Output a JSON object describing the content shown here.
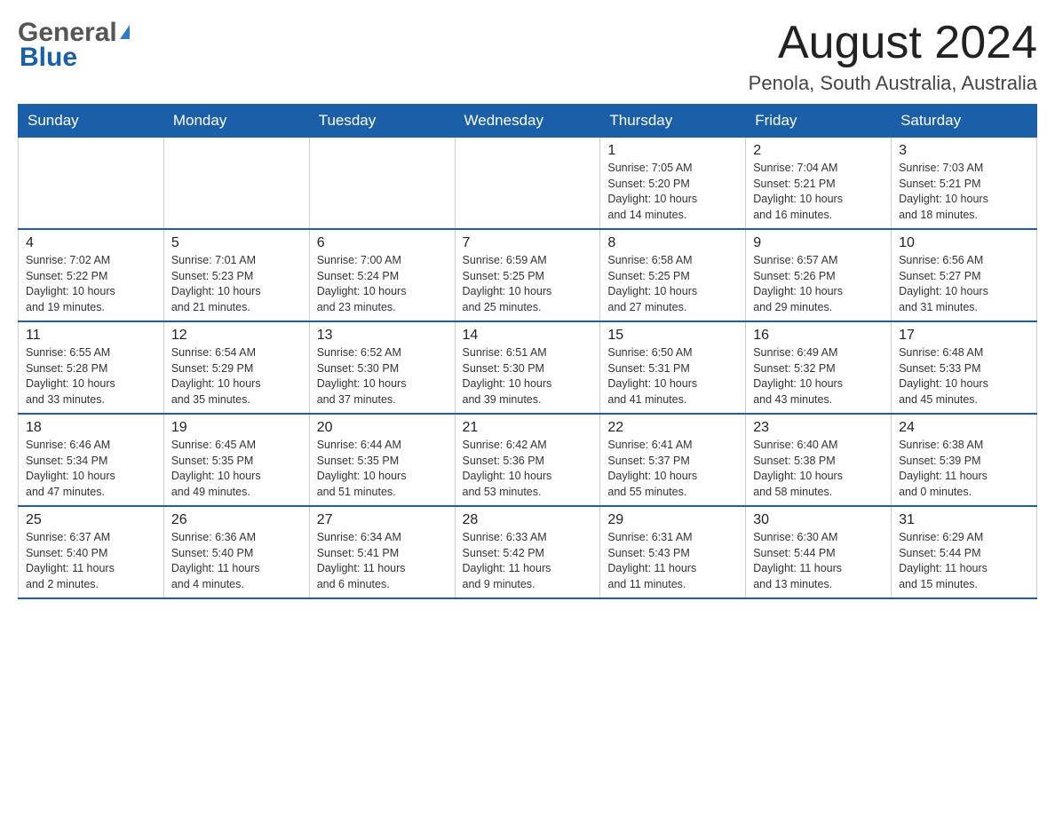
{
  "header": {
    "logo_general": "General",
    "logo_blue": "Blue",
    "month_title": "August 2024",
    "location": "Penola, South Australia, Australia"
  },
  "weekdays": [
    "Sunday",
    "Monday",
    "Tuesday",
    "Wednesday",
    "Thursday",
    "Friday",
    "Saturday"
  ],
  "weeks": [
    [
      {
        "day": "",
        "detail": ""
      },
      {
        "day": "",
        "detail": ""
      },
      {
        "day": "",
        "detail": ""
      },
      {
        "day": "",
        "detail": ""
      },
      {
        "day": "1",
        "detail": "Sunrise: 7:05 AM\nSunset: 5:20 PM\nDaylight: 10 hours\nand 14 minutes."
      },
      {
        "day": "2",
        "detail": "Sunrise: 7:04 AM\nSunset: 5:21 PM\nDaylight: 10 hours\nand 16 minutes."
      },
      {
        "day": "3",
        "detail": "Sunrise: 7:03 AM\nSunset: 5:21 PM\nDaylight: 10 hours\nand 18 minutes."
      }
    ],
    [
      {
        "day": "4",
        "detail": "Sunrise: 7:02 AM\nSunset: 5:22 PM\nDaylight: 10 hours\nand 19 minutes."
      },
      {
        "day": "5",
        "detail": "Sunrise: 7:01 AM\nSunset: 5:23 PM\nDaylight: 10 hours\nand 21 minutes."
      },
      {
        "day": "6",
        "detail": "Sunrise: 7:00 AM\nSunset: 5:24 PM\nDaylight: 10 hours\nand 23 minutes."
      },
      {
        "day": "7",
        "detail": "Sunrise: 6:59 AM\nSunset: 5:25 PM\nDaylight: 10 hours\nand 25 minutes."
      },
      {
        "day": "8",
        "detail": "Sunrise: 6:58 AM\nSunset: 5:25 PM\nDaylight: 10 hours\nand 27 minutes."
      },
      {
        "day": "9",
        "detail": "Sunrise: 6:57 AM\nSunset: 5:26 PM\nDaylight: 10 hours\nand 29 minutes."
      },
      {
        "day": "10",
        "detail": "Sunrise: 6:56 AM\nSunset: 5:27 PM\nDaylight: 10 hours\nand 31 minutes."
      }
    ],
    [
      {
        "day": "11",
        "detail": "Sunrise: 6:55 AM\nSunset: 5:28 PM\nDaylight: 10 hours\nand 33 minutes."
      },
      {
        "day": "12",
        "detail": "Sunrise: 6:54 AM\nSunset: 5:29 PM\nDaylight: 10 hours\nand 35 minutes."
      },
      {
        "day": "13",
        "detail": "Sunrise: 6:52 AM\nSunset: 5:30 PM\nDaylight: 10 hours\nand 37 minutes."
      },
      {
        "day": "14",
        "detail": "Sunrise: 6:51 AM\nSunset: 5:30 PM\nDaylight: 10 hours\nand 39 minutes."
      },
      {
        "day": "15",
        "detail": "Sunrise: 6:50 AM\nSunset: 5:31 PM\nDaylight: 10 hours\nand 41 minutes."
      },
      {
        "day": "16",
        "detail": "Sunrise: 6:49 AM\nSunset: 5:32 PM\nDaylight: 10 hours\nand 43 minutes."
      },
      {
        "day": "17",
        "detail": "Sunrise: 6:48 AM\nSunset: 5:33 PM\nDaylight: 10 hours\nand 45 minutes."
      }
    ],
    [
      {
        "day": "18",
        "detail": "Sunrise: 6:46 AM\nSunset: 5:34 PM\nDaylight: 10 hours\nand 47 minutes."
      },
      {
        "day": "19",
        "detail": "Sunrise: 6:45 AM\nSunset: 5:35 PM\nDaylight: 10 hours\nand 49 minutes."
      },
      {
        "day": "20",
        "detail": "Sunrise: 6:44 AM\nSunset: 5:35 PM\nDaylight: 10 hours\nand 51 minutes."
      },
      {
        "day": "21",
        "detail": "Sunrise: 6:42 AM\nSunset: 5:36 PM\nDaylight: 10 hours\nand 53 minutes."
      },
      {
        "day": "22",
        "detail": "Sunrise: 6:41 AM\nSunset: 5:37 PM\nDaylight: 10 hours\nand 55 minutes."
      },
      {
        "day": "23",
        "detail": "Sunrise: 6:40 AM\nSunset: 5:38 PM\nDaylight: 10 hours\nand 58 minutes."
      },
      {
        "day": "24",
        "detail": "Sunrise: 6:38 AM\nSunset: 5:39 PM\nDaylight: 11 hours\nand 0 minutes."
      }
    ],
    [
      {
        "day": "25",
        "detail": "Sunrise: 6:37 AM\nSunset: 5:40 PM\nDaylight: 11 hours\nand 2 minutes."
      },
      {
        "day": "26",
        "detail": "Sunrise: 6:36 AM\nSunset: 5:40 PM\nDaylight: 11 hours\nand 4 minutes."
      },
      {
        "day": "27",
        "detail": "Sunrise: 6:34 AM\nSunset: 5:41 PM\nDaylight: 11 hours\nand 6 minutes."
      },
      {
        "day": "28",
        "detail": "Sunrise: 6:33 AM\nSunset: 5:42 PM\nDaylight: 11 hours\nand 9 minutes."
      },
      {
        "day": "29",
        "detail": "Sunrise: 6:31 AM\nSunset: 5:43 PM\nDaylight: 11 hours\nand 11 minutes."
      },
      {
        "day": "30",
        "detail": "Sunrise: 6:30 AM\nSunset: 5:44 PM\nDaylight: 11 hours\nand 13 minutes."
      },
      {
        "day": "31",
        "detail": "Sunrise: 6:29 AM\nSunset: 5:44 PM\nDaylight: 11 hours\nand 15 minutes."
      }
    ]
  ]
}
